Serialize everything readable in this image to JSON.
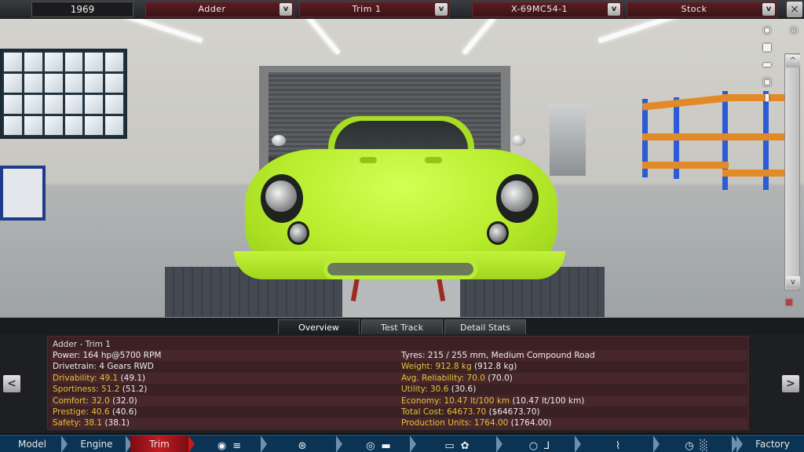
{
  "topbar": {
    "year": "1969",
    "model": "Adder",
    "trim": "Trim 1",
    "engine": "X-69MC54-1",
    "variant": "Stock",
    "dropdown_btn": "v",
    "close": "×"
  },
  "viewtools": {
    "icons": [
      "camera-icon",
      "eye-icon",
      "car-side-view-icon",
      "car-front-view-icon",
      "car-top-view-icon",
      "car-rear-view-icon",
      "car-door-open-icon"
    ],
    "scroll_up": "^",
    "scroll_down": "v"
  },
  "tabs": {
    "overview": "Overview",
    "test_track": "Test Track",
    "detail_stats": "Detail Stats"
  },
  "stats": {
    "title": "Adder - Trim 1",
    "left": [
      {
        "label": "Power: ",
        "value": "164 hp@5700 RPM",
        "ref": "",
        "gold": false
      },
      {
        "label": "Drivetrain: ",
        "value": "4 Gears RWD",
        "ref": "",
        "gold": false
      },
      {
        "label": "Drivability: ",
        "value": "49.1",
        "ref": " (49.1)",
        "gold": true
      },
      {
        "label": "Sportiness: ",
        "value": "51.2",
        "ref": " (51.2)",
        "gold": true
      },
      {
        "label": "Comfort: ",
        "value": "32.0",
        "ref": " (32.0)",
        "gold": true
      },
      {
        "label": "Prestige: ",
        "value": "40.6",
        "ref": " (40.6)",
        "gold": true
      },
      {
        "label": "Safety: ",
        "value": "38.1",
        "ref": " (38.1)",
        "gold": true
      }
    ],
    "right": [
      {
        "label": "Tyres: ",
        "value": "215 / 255 mm, Medium Compound Road",
        "ref": "",
        "gold": false
      },
      {
        "label": "Weight: ",
        "value": "912.8 kg",
        "ref": " (912.8 kg)",
        "gold": true
      },
      {
        "label": "Avg. Reliability: ",
        "value": "70.0",
        "ref": " (70.0)",
        "gold": true
      },
      {
        "label": "Utility: ",
        "value": "30.6",
        "ref": " (30.6)",
        "gold": true
      },
      {
        "label": "Economy: ",
        "value": "10.47 lt/100 km",
        "ref": " (10.47 lt/100 km)",
        "gold": true
      },
      {
        "label": "Total Cost: ",
        "value": "64673.70",
        "ref": " ($64673.70)",
        "gold": true
      },
      {
        "label": "Production Units: ",
        "value": "1764.00",
        "ref": " (1764.00)",
        "gold": true
      }
    ],
    "prev": "<",
    "next": ">"
  },
  "nav": {
    "model": "Model",
    "engine": "Engine",
    "trim": "Trim",
    "factory": "Factory",
    "icon_groups": [
      [
        "chassis-icon",
        "gearbox-icon"
      ],
      [
        "wheels-icon"
      ],
      [
        "suspension-icon",
        "body-icon"
      ],
      [
        "car-body-icon",
        "fan-icon"
      ],
      [
        "steering-wheel-icon",
        "seat-icon"
      ],
      [
        "spring-icon"
      ],
      [
        "speedometer-icon",
        "checkered-flag-icon"
      ]
    ]
  },
  "colors": {
    "car_paint": "#b7ec2c",
    "active_tab": "#c31b23",
    "stat_gold": "#e7c235",
    "panel_bg": "#3b2124",
    "nav_bg": "#0b3354"
  }
}
